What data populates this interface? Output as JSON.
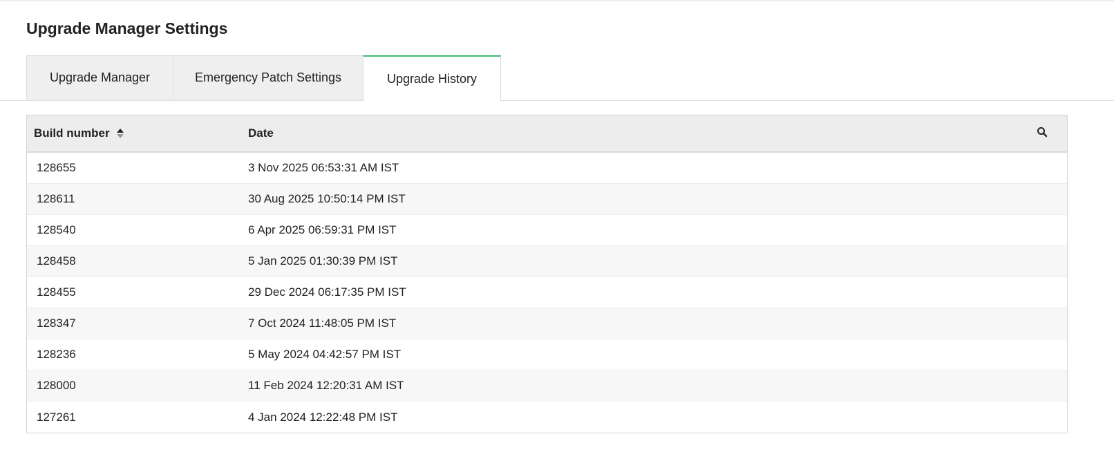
{
  "page_title": "Upgrade Manager Settings",
  "tabs": [
    {
      "label": "Upgrade Manager"
    },
    {
      "label": "Emergency Patch Settings"
    },
    {
      "label": "Upgrade History",
      "active": true
    }
  ],
  "accent_color": "#3cb878",
  "table": {
    "headers": {
      "build": "Build number",
      "date": "Date"
    },
    "rows": [
      {
        "build": "128655",
        "date": "3 Nov 2025 06:53:31 AM IST"
      },
      {
        "build": "128611",
        "date": "30 Aug 2025 10:50:14 PM IST"
      },
      {
        "build": "128540",
        "date": "6 Apr 2025 06:59:31 PM IST"
      },
      {
        "build": "128458",
        "date": "5 Jan 2025 01:30:39 PM IST"
      },
      {
        "build": "128455",
        "date": "29 Dec 2024 06:17:35 PM IST"
      },
      {
        "build": "128347",
        "date": "7 Oct 2024 11:48:05 PM IST"
      },
      {
        "build": "128236",
        "date": "5 May 2024 04:42:57 PM IST"
      },
      {
        "build": "128000",
        "date": "11 Feb 2024 12:20:31 AM IST"
      },
      {
        "build": "127261",
        "date": "4 Jan 2024 12:22:48 PM IST"
      }
    ]
  }
}
